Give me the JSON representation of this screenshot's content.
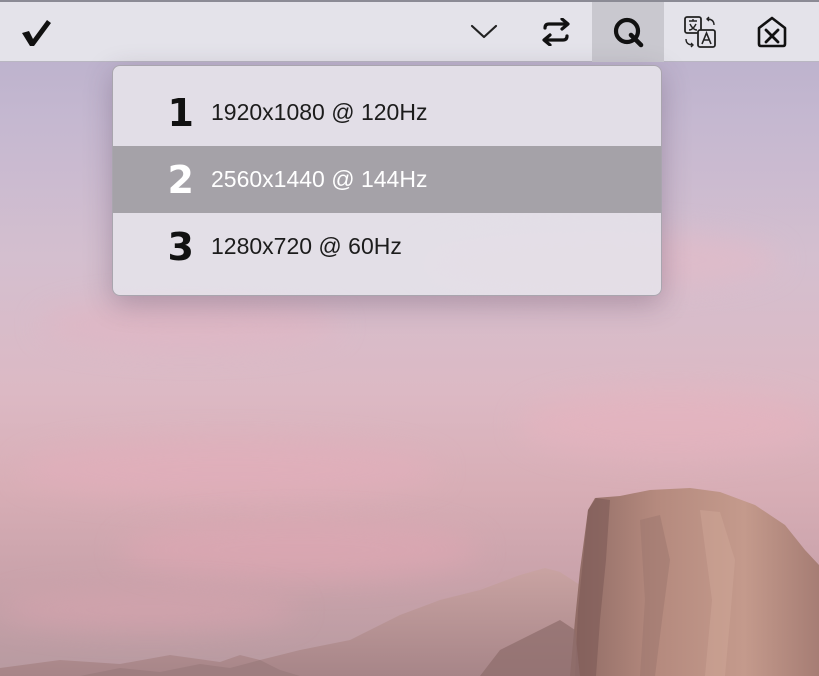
{
  "toolbar": {
    "buttons": [
      {
        "icon": "checkmark-icon"
      },
      {
        "icon": "chevron-down-icon"
      },
      {
        "icon": "swap-arrows-icon"
      },
      {
        "icon": "q-icon",
        "active": true
      },
      {
        "icon": "translate-icon"
      },
      {
        "icon": "delete-icon"
      }
    ]
  },
  "menu": {
    "items": [
      {
        "number": "1",
        "label": "1920x1080 @ 120Hz",
        "selected": false
      },
      {
        "number": "2",
        "label": "2560x1440 @ 144Hz",
        "selected": true
      },
      {
        "number": "3",
        "label": "1280x720 @ 60Hz",
        "selected": false
      }
    ]
  },
  "colors": {
    "toolbar_bg": "#e4e3ea",
    "menu_bg": "#e4e1e8",
    "selection_bg": "#a5a2a8",
    "wallpaper_sky": "#c5b8d0",
    "mountain": "#b0857a"
  }
}
